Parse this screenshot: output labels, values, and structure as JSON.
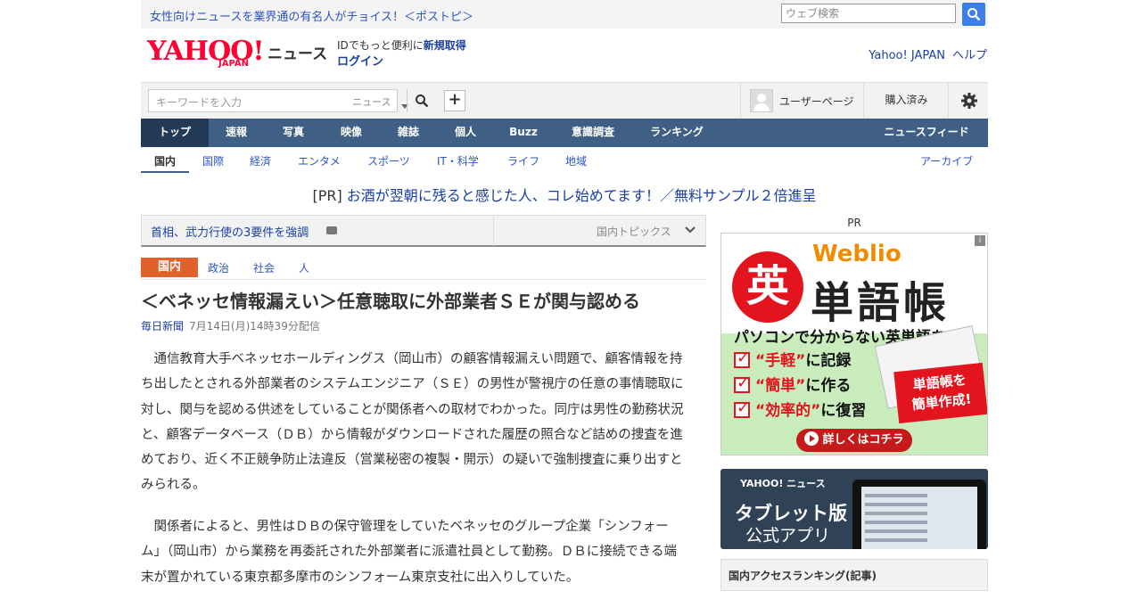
{
  "topbar": {
    "promo": "女性向けニュースを業界通の有名人がチョイス！＜ポストピ＞",
    "search_placeholder": "ウェブ検索"
  },
  "header": {
    "logo_main": "YAHOO!",
    "logo_sub": "JAPAN",
    "service": "ニュース",
    "id_text": "IDでもっと便利に",
    "register": "新規取得",
    "login": "ログイン",
    "links": [
      "Yahoo! JAPAN",
      "ヘルプ"
    ]
  },
  "search": {
    "placeholder": "キーワードを入力",
    "scope": "ニュース",
    "plus": "+",
    "user_page": "ユーザーページ",
    "purchased": "購入済み"
  },
  "main_nav": [
    "トップ",
    "速報",
    "写真",
    "映像",
    "雑誌",
    "個人",
    "Buzz",
    "意識調査",
    "ランキング",
    "ニュースフィード"
  ],
  "sub_nav": [
    "国内",
    "国際",
    "経済",
    "エンタメ",
    "スポーツ",
    "IT・科学",
    "ライフ",
    "地域",
    "アーカイブ"
  ],
  "pr_line": {
    "tag": "[PR]",
    "text": "お酒が翌朝に残ると感じた人、コレ始めてます！／無料サンプル２倍進呈"
  },
  "topic_bar": {
    "title": "首相、武力行使の3要件を強調",
    "label": "国内トピックス"
  },
  "category": {
    "main": "国内",
    "tags": [
      "政治",
      "社会",
      "人"
    ]
  },
  "article": {
    "headline": "＜ベネッセ情報漏えい＞任意聴取に外部業者ＳＥが関与認める",
    "source": "毎日新聞",
    "date": "7月14日(月)14時39分配信",
    "paragraphs": [
      [
        "　通信教育大手ベネッセホールディングス（岡山市）の顧客情報漏えい問題で、顧客情報を持",
        "ち出したとされる外部業者のシステムエンジニア（ＳＥ）の男性が警視庁の任意の事情聴取に",
        "対し、関与を認める供述をしていることが関係者への取材でわかった。同庁は男性の勤務状況",
        "と、顧客データベース（ＤＢ）から情報がダウンロードされた履歴の照合など詰めの捜査を進",
        "めており、近く不正競争防止法違反（営業秘密の複製・開示）の疑いで強制捜査に乗り出すと",
        "みられる。"
      ],
      [
        "　関係者によると、男性はＤＢの保守管理をしていたベネッセのグループ企業「シンフォー",
        "ム」（岡山市）から業務を再委託された外部業者に派遣社員として勤務。ＤＢに接続できる端",
        "末が置かれている東京都多摩市のシンフォーム東京支社に出入りしていた。"
      ]
    ]
  },
  "sidebar": {
    "pr_label": "PR",
    "ad": {
      "ei": "英",
      "brand": "Weblio",
      "title": "単語帳",
      "sub": "パソコンで分からない英単語を",
      "rows": [
        {
          "q": "“手軽”",
          "rest": "に記録"
        },
        {
          "q": "“簡単”",
          "rest": "に作る"
        },
        {
          "q": "“効率的”",
          "rest": "に復習"
        }
      ],
      "stamp": [
        "単語帳を",
        "簡単作成!"
      ],
      "button": "詳しくはコチラ",
      "info": "i"
    },
    "tablet": {
      "logo": "YAHOO! ニュース",
      "line1": "タブレット版",
      "line2": "公式アプリ"
    },
    "ranking_title": "国内アクセスランキング(記事)"
  },
  "colors": {
    "nav_bg": "#3f5f84",
    "nav_active": "#233a57",
    "link": "#1a3fa5",
    "category": "#e0612a",
    "brand_red": "#ff0033"
  }
}
